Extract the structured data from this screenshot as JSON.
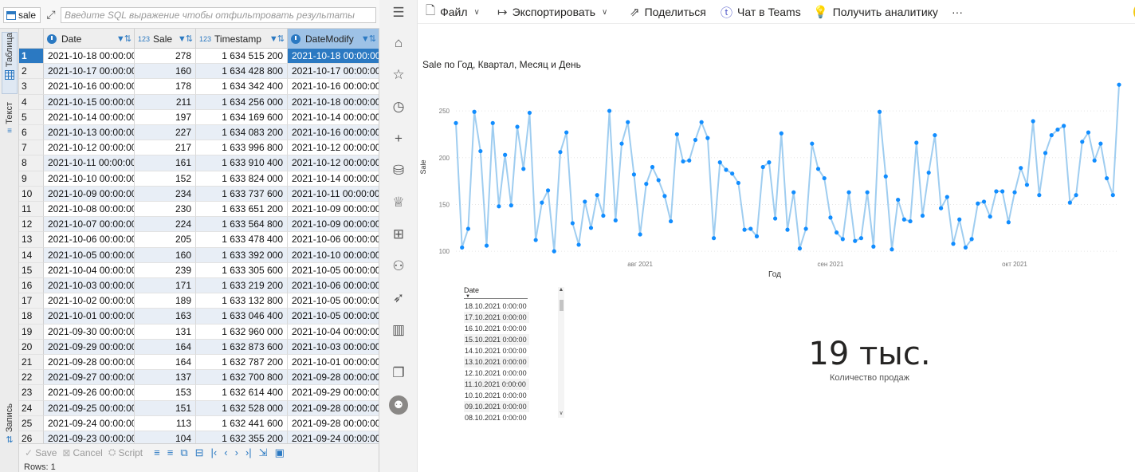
{
  "sql_viewer": {
    "table_name": "sale",
    "filter_placeholder": "Введите SQL выражение чтобы отфильтровать результаты",
    "side_tabs": {
      "table": "Таблица",
      "text": "Текст",
      "record": "Запись"
    },
    "columns": [
      {
        "type": "clock-icon",
        "name": "Date"
      },
      {
        "type": "123",
        "name": "Sale"
      },
      {
        "type": "123",
        "name": "Timestamp"
      },
      {
        "type": "clock-icon",
        "name": "DateModify"
      }
    ],
    "rows": [
      [
        "1",
        "2021-10-18 00:00:00",
        "278",
        "1 634 515 200",
        "2021-10-18 00:00:00"
      ],
      [
        "2",
        "2021-10-17 00:00:00",
        "160",
        "1 634 428 800",
        "2021-10-17 00:00:00"
      ],
      [
        "3",
        "2021-10-16 00:00:00",
        "178",
        "1 634 342 400",
        "2021-10-16 00:00:00"
      ],
      [
        "4",
        "2021-10-15 00:00:00",
        "211",
        "1 634 256 000",
        "2021-10-18 00:00:00"
      ],
      [
        "5",
        "2021-10-14 00:00:00",
        "197",
        "1 634 169 600",
        "2021-10-14 00:00:00"
      ],
      [
        "6",
        "2021-10-13 00:00:00",
        "227",
        "1 634 083 200",
        "2021-10-16 00:00:00"
      ],
      [
        "7",
        "2021-10-12 00:00:00",
        "217",
        "1 633 996 800",
        "2021-10-12 00:00:00"
      ],
      [
        "8",
        "2021-10-11 00:00:00",
        "161",
        "1 633 910 400",
        "2021-10-12 00:00:00"
      ],
      [
        "9",
        "2021-10-10 00:00:00",
        "152",
        "1 633 824 000",
        "2021-10-14 00:00:00"
      ],
      [
        "10",
        "2021-10-09 00:00:00",
        "234",
        "1 633 737 600",
        "2021-10-11 00:00:00"
      ],
      [
        "11",
        "2021-10-08 00:00:00",
        "230",
        "1 633 651 200",
        "2021-10-09 00:00:00"
      ],
      [
        "12",
        "2021-10-07 00:00:00",
        "224",
        "1 633 564 800",
        "2021-10-09 00:00:00"
      ],
      [
        "13",
        "2021-10-06 00:00:00",
        "205",
        "1 633 478 400",
        "2021-10-06 00:00:00"
      ],
      [
        "14",
        "2021-10-05 00:00:00",
        "160",
        "1 633 392 000",
        "2021-10-10 00:00:00"
      ],
      [
        "15",
        "2021-10-04 00:00:00",
        "239",
        "1 633 305 600",
        "2021-10-05 00:00:00"
      ],
      [
        "16",
        "2021-10-03 00:00:00",
        "171",
        "1 633 219 200",
        "2021-10-06 00:00:00"
      ],
      [
        "17",
        "2021-10-02 00:00:00",
        "189",
        "1 633 132 800",
        "2021-10-05 00:00:00"
      ],
      [
        "18",
        "2021-10-01 00:00:00",
        "163",
        "1 633 046 400",
        "2021-10-05 00:00:00"
      ],
      [
        "19",
        "2021-09-30 00:00:00",
        "131",
        "1 632 960 000",
        "2021-10-04 00:00:00"
      ],
      [
        "20",
        "2021-09-29 00:00:00",
        "164",
        "1 632 873 600",
        "2021-10-03 00:00:00"
      ],
      [
        "21",
        "2021-09-28 00:00:00",
        "164",
        "1 632 787 200",
        "2021-10-01 00:00:00"
      ],
      [
        "22",
        "2021-09-27 00:00:00",
        "137",
        "1 632 700 800",
        "2021-09-28 00:00:00"
      ],
      [
        "23",
        "2021-09-26 00:00:00",
        "153",
        "1 632 614 400",
        "2021-09-29 00:00:00"
      ],
      [
        "24",
        "2021-09-25 00:00:00",
        "151",
        "1 632 528 000",
        "2021-09-28 00:00:00"
      ],
      [
        "25",
        "2021-09-24 00:00:00",
        "113",
        "1 632 441 600",
        "2021-09-28 00:00:00"
      ],
      [
        "26",
        "2021-09-23 00:00:00",
        "104",
        "1 632 355 200",
        "2021-09-24 00:00:00"
      ]
    ],
    "bottom": {
      "save": "Save",
      "cancel": "Cancel",
      "script": "Script"
    },
    "rows_status": "Rows: 1"
  },
  "pbi": {
    "toolbar": {
      "file": "Файл",
      "export": "Экспортировать",
      "share": "Поделиться",
      "teams": "Чат в Teams",
      "insights": "Получить аналитику",
      "more": "···"
    },
    "nav_icons": [
      "home-icon",
      "favorites-icon",
      "recent-icon",
      "create-icon",
      "datasets-icon",
      "goals-icon",
      "apps-icon",
      "shared-icon",
      "deployment-icon",
      "learn-icon",
      "workspaces-icon",
      "my-workspace-icon"
    ],
    "card": {
      "value": "19 тыс.",
      "label": "Количество продаж"
    },
    "slicer": {
      "title": "Date",
      "items": [
        "18.10.2021 0:00:00",
        "17.10.2021 0:00:00",
        "16.10.2021 0:00:00",
        "15.10.2021 0:00:00",
        "14.10.2021 0:00:00",
        "13.10.2021 0:00:00",
        "12.10.2021 0:00:00",
        "11.10.2021 0:00:00",
        "10.10.2021 0:00:00",
        "09.10.2021 0:00:00",
        "08.10.2021 0:00:00"
      ]
    }
  },
  "chart_data": {
    "type": "line",
    "title": "Sale по Год, Квартал, Месяц и День",
    "xlabel": "Год",
    "ylabel": "Sale",
    "x_ticks": [
      "авг 2021",
      "сен 2021",
      "окт 2021"
    ],
    "y_ticks": [
      100,
      150,
      200,
      250
    ],
    "ylim": [
      95,
      285
    ],
    "grid": true,
    "color": "#9fcdf0",
    "marker_color": "#118dff",
    "values": [
      237,
      104,
      124,
      249,
      207,
      106,
      237,
      148,
      203,
      149,
      233,
      188,
      248,
      112,
      152,
      165,
      100,
      206,
      227,
      130,
      107,
      153,
      125,
      160,
      138,
      250,
      133,
      215,
      238,
      182,
      118,
      172,
      190,
      176,
      159,
      132,
      225,
      196,
      197,
      219,
      238,
      221,
      114,
      195,
      187,
      183,
      173,
      123,
      124,
      116,
      190,
      195,
      135,
      226,
      123,
      163,
      103,
      124,
      215,
      188,
      178,
      136,
      120,
      113,
      163,
      111,
      114,
      163,
      105,
      249,
      180,
      102,
      155,
      134,
      132,
      216,
      138,
      184,
      224,
      146,
      158,
      108,
      134,
      104,
      113,
      151,
      153,
      137,
      164,
      164,
      131,
      163,
      189,
      171,
      239,
      160,
      205,
      224,
      230,
      234,
      152,
      160,
      217,
      227,
      197,
      215,
      178,
      160,
      278
    ],
    "first_date": "2021-07-02"
  }
}
